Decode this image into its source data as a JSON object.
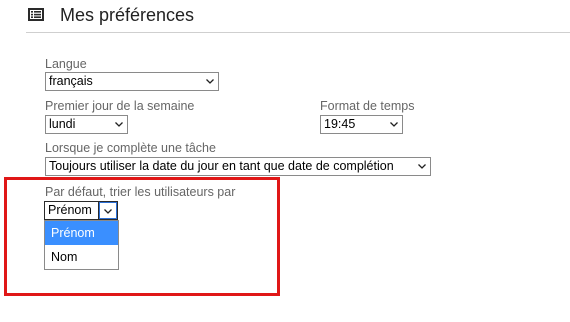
{
  "header": {
    "title": "Mes préférences",
    "icon": "list-icon"
  },
  "language": {
    "label": "Langue",
    "value": "français"
  },
  "week_start": {
    "label": "Premier jour de la semaine",
    "value": "lundi"
  },
  "time_format": {
    "label": "Format de temps",
    "value": "19:45"
  },
  "task_complete": {
    "label": "Lorsque je complète une tâche",
    "value": "Toujours utiliser la date du jour en tant que date de complétion"
  },
  "user_sort": {
    "label": "Par défaut, trier les utilisateurs par",
    "value": "Prénom",
    "options": [
      "Prénom",
      "Nom"
    ],
    "highlighted_option": "Prénom"
  },
  "colors": {
    "highlight_box": "#e01717",
    "option_hover": "#3a8fff",
    "focus": "#2b6fd6"
  }
}
